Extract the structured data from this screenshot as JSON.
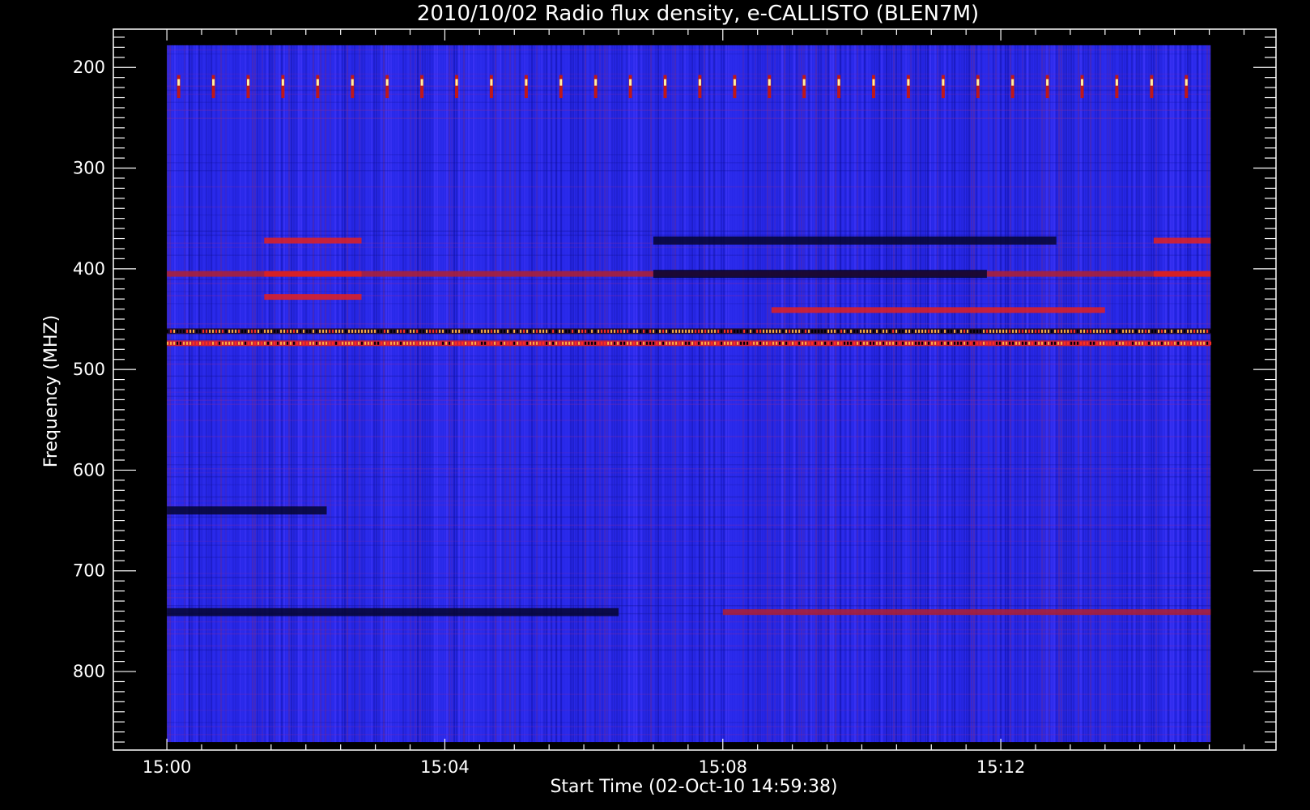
{
  "chart_data": {
    "type": "heatmap",
    "title": "2010/10/02  Radio flux density, e-CALLISTO (BLEN7M)",
    "xlabel": "Start Time (02-Oct-10 14:59:38)",
    "ylabel": "Frequency (MHZ)",
    "x_tick_labels": [
      "15:00",
      "15:04",
      "15:08",
      "15:12"
    ],
    "x_tick_minutes": [
      0,
      4,
      8,
      12
    ],
    "xlim_minutes_after_1500": [
      -0.77,
      15.96
    ],
    "data_range_minutes_after_1500": [
      0,
      15.02
    ],
    "y_tick_labels": [
      "200",
      "300",
      "400",
      "500",
      "600",
      "700",
      "800"
    ],
    "y_tick_values": [
      200,
      300,
      400,
      500,
      600,
      700,
      800
    ],
    "ylim": [
      878,
      162
    ],
    "data_freq_range": [
      178,
      870
    ],
    "y_inverted": true,
    "colormap": [
      "#000000",
      "#0000c8",
      "#3a32ff",
      "#d2281e",
      "#ff7800",
      "#fff5a0"
    ],
    "background_color": "#2828e8",
    "features": [
      {
        "kind": "periodic-pulses",
        "freq_range": [
          210,
          228
        ],
        "start_min": 0.17,
        "period_min": 0.5,
        "intensity": "high"
      },
      {
        "kind": "band",
        "freq": 372,
        "t_range": [
          1.4,
          2.8
        ],
        "intensity": "high"
      },
      {
        "kind": "band",
        "freq": 405,
        "t_range": [
          0,
          15.02
        ],
        "intensity": "medium"
      },
      {
        "kind": "band",
        "freq": 405,
        "t_range": [
          1.4,
          2.8
        ],
        "intensity": "high"
      },
      {
        "kind": "band",
        "freq": 428,
        "t_range": [
          1.4,
          2.8
        ],
        "intensity": "high"
      },
      {
        "kind": "band",
        "freq": 372,
        "t_range": [
          7.0,
          12.8
        ],
        "intensity": "low"
      },
      {
        "kind": "band",
        "freq": 405,
        "t_range": [
          7.0,
          11.8
        ],
        "intensity": "low"
      },
      {
        "kind": "band",
        "freq": 441,
        "t_range": [
          8.7,
          13.5
        ],
        "intensity": "high"
      },
      {
        "kind": "band",
        "freq": 462,
        "t_range": [
          0,
          15.02
        ],
        "intensity": "mixed"
      },
      {
        "kind": "band",
        "freq": 474,
        "t_range": [
          0,
          15.02
        ],
        "intensity": "high"
      },
      {
        "kind": "band",
        "freq": 640,
        "t_range": [
          0,
          2.3
        ],
        "intensity": "low"
      },
      {
        "kind": "band",
        "freq": 741,
        "t_range": [
          0,
          6.5
        ],
        "intensity": "low"
      },
      {
        "kind": "band",
        "freq": 741,
        "t_range": [
          8.0,
          15.02
        ],
        "intensity": "medium"
      },
      {
        "kind": "band",
        "freq": 372,
        "t_range": [
          14.2,
          15.02
        ],
        "intensity": "high"
      },
      {
        "kind": "band",
        "freq": 405,
        "t_range": [
          14.2,
          15.02
        ],
        "intensity": "high"
      }
    ]
  }
}
